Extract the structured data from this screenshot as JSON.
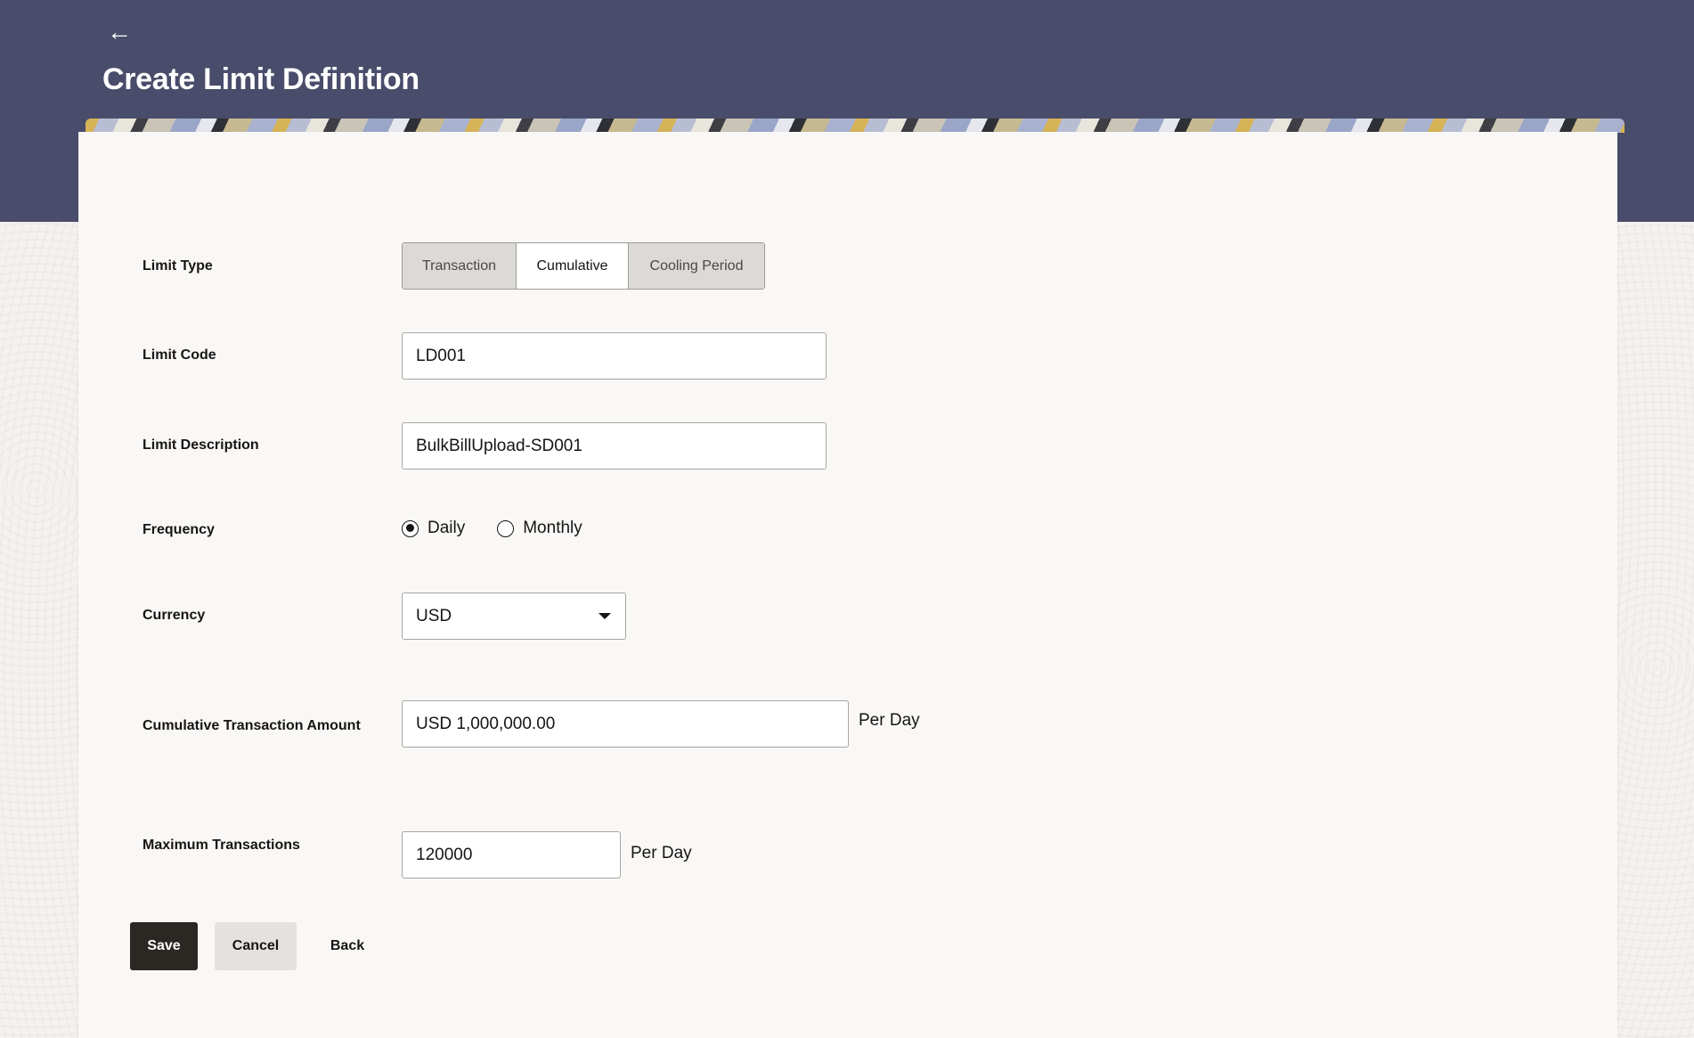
{
  "header": {
    "title": "Create Limit Definition",
    "back_icon": "arrow-left-icon"
  },
  "form": {
    "limit_type": {
      "label": "Limit Type",
      "options": [
        "Transaction",
        "Cumulative",
        "Cooling Period"
      ],
      "selected": "Cumulative"
    },
    "limit_code": {
      "label": "Limit Code",
      "value": "LD001"
    },
    "limit_description": {
      "label": "Limit Description",
      "value": "BulkBillUpload-SD001"
    },
    "frequency": {
      "label": "Frequency",
      "options": [
        "Daily",
        "Monthly"
      ],
      "selected": "Daily"
    },
    "currency": {
      "label": "Currency",
      "value": "USD"
    },
    "cumulative_amount": {
      "label": "Cumulative Transaction Amount",
      "value": "USD 1,000,000.00",
      "suffix": "Per Day"
    },
    "max_transactions": {
      "label": "Maximum Transactions",
      "value": "120000",
      "suffix": "Per Day"
    }
  },
  "actions": {
    "save": "Save",
    "cancel": "Cancel",
    "back": "Back"
  },
  "colors": {
    "header_bg": "#494c6a",
    "primary_button": "#2b2824",
    "card_bg": "#f9f8f6"
  }
}
